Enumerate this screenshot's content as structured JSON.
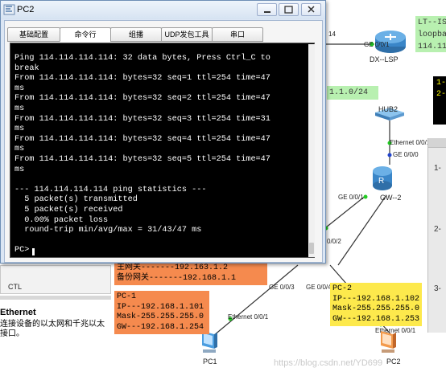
{
  "window": {
    "title": "PC2",
    "tabs": [
      {
        "label": "基础配置",
        "active": false
      },
      {
        "label": "命令行",
        "active": true
      },
      {
        "label": "组播",
        "active": false
      },
      {
        "label": "UDP发包工具",
        "active": false
      },
      {
        "label": "串口",
        "active": false
      }
    ],
    "console_lines": [
      "Ping 114.114.114.114: 32 data bytes, Press Ctrl_C to",
      "break",
      "From 114.114.114.114: bytes=32 seq=1 ttl=254 time=47",
      "ms",
      "From 114.114.114.114: bytes=32 seq=2 ttl=254 time=47",
      "ms",
      "From 114.114.114.114: bytes=32 seq=3 ttl=254 time=31",
      "ms",
      "From 114.114.114.114: bytes=32 seq=4 ttl=254 time=47",
      "ms",
      "From 114.114.114.114: bytes=32 seq=5 ttl=254 time=47",
      "ms",
      "",
      "--- 114.114.114.114 ping statistics ---",
      "  5 packet(s) transmitted",
      "  5 packet(s) received",
      "  0.00% packet loss",
      "  round-trip min/avg/max = 31/43/47 ms"
    ],
    "prompt": "PC>"
  },
  "topology": {
    "dx_lsp": {
      "name": "DX--LSP",
      "port": "GE 0/0/1"
    },
    "partial_port": "14",
    "hub2": {
      "name": "HUB2"
    },
    "gw2": {
      "name": "GW--2",
      "port_top": "Ethernet 0/0/1",
      "port_top2": "GE 0/0/0",
      "port_left": "GE 0/0/1"
    },
    "switch_ports": {
      "left": "GE 0/0/3",
      "right": "GE 0/0/4",
      "up": "0/0/2"
    },
    "pc1": {
      "name": "PC1",
      "port": "Ethernet 0/0/1"
    },
    "pc2": {
      "name": "PC2",
      "port": "Ethernet 0/0/1"
    },
    "note_lt": "LT--IS\nloopba\n114.11",
    "note_net": "1.1.0/24",
    "note_black": "1-\n2-",
    "note_gw": "主网关-------192.163.1.2\n备份网关-------192.168.1.1",
    "note_pc1": "PC-1\nIP---192.168.1.101\nMask-255.255.255.0\nGW---192.168.1.254",
    "note_pc2": "PC-2\nIP---192.168.1.102\nMask-255.255.255.0\nGW---192.168.1.253",
    "right_rows": [
      "1-",
      "2-",
      "3-"
    ]
  },
  "left_panel": {
    "ctl_label": "CTL",
    "desc_title": "Ethernet",
    "desc_text": "连接设备的以太网和千兆以太接口。"
  },
  "watermark": "https://blog.csdn.net/YD699",
  "colors": {
    "console_bg": "#000000",
    "note_green": "#b8f0b0",
    "note_orange": "#f58a4e",
    "note_yellow": "#fde94c",
    "link_green": "#22cc22",
    "router_blue": "#3a86c8"
  }
}
